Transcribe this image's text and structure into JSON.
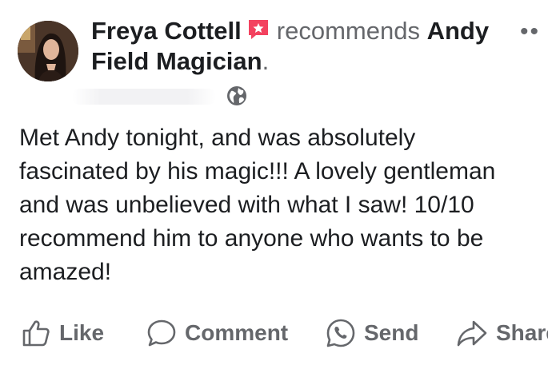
{
  "post": {
    "author": "Freya Cottell",
    "verb": "recommends",
    "page_name_part1": "Andy",
    "page_name_part2": "Field Magician",
    "period": ".",
    "more_menu": "••",
    "text": "Met Andy tonight, and was absolutely\nfascinated by his magic!!! A lovely gentleman\nand was unbelieved with what I saw! 10/10\nrecommend him to anyone who wants to be\namazed!"
  },
  "icons": {
    "recommendation": "recommend-star-icon",
    "audience": "globe-icon",
    "like": "thumbs-up-icon",
    "comment": "speech-bubble-icon",
    "send": "whatsapp-icon",
    "share": "share-arrow-icon"
  },
  "actions": {
    "like": "Like",
    "comment": "Comment",
    "send": "Send",
    "share": "Share"
  },
  "colors": {
    "text": "#1c1e21",
    "secondary": "#65676b",
    "recommend_badge": "#f3425f"
  }
}
